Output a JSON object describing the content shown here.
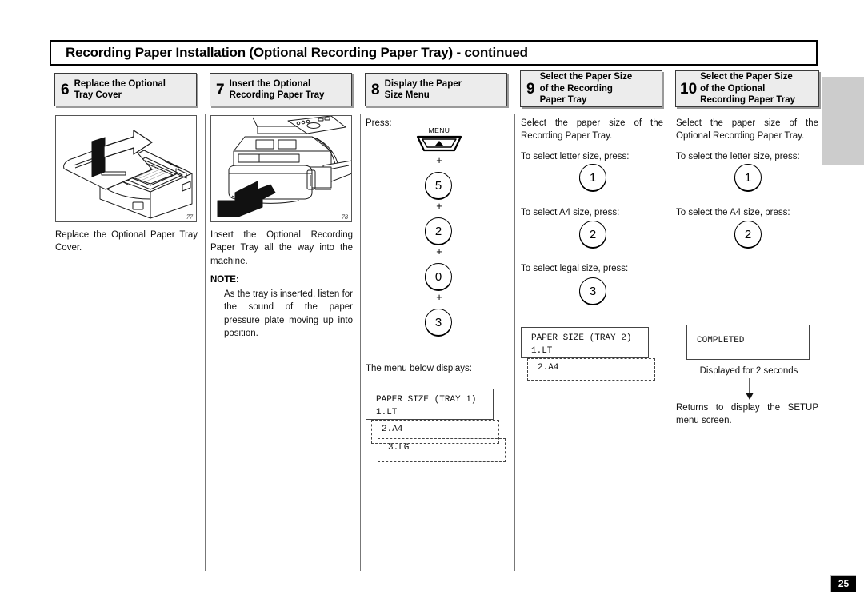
{
  "page": {
    "title": "Recording Paper Installation (Optional Recording Paper Tray) - continued",
    "page_number": "25",
    "colors": {
      "step_header_bg": "#ececec",
      "step_header_border": "#3a3a3a",
      "thumb_tab": "#cccccc",
      "divider": "#777777",
      "page_number_bg": "#000000",
      "page_number_text": "#ffffff"
    }
  },
  "steps": [
    {
      "number": "6",
      "label": "Replace the Optional\nTray Cover",
      "figure_number": "77",
      "figure_alt": "optional-paper-tray-cover-illustration",
      "body": "Replace the Optional Paper Tray Cover."
    },
    {
      "number": "7",
      "label": "Insert the Optional\nRecording Paper Tray",
      "figure_number": "78",
      "figure_alt": "insert-recording-paper-tray-illustration",
      "body": "Insert the Optional Recording Paper Tray all the way into the machine.",
      "note_title": "NOTE:",
      "note_body": "As the tray is inserted, listen for the sound of the paper pressure plate moving up into position."
    },
    {
      "number": "8",
      "label": "Display the Paper\nSize Menu",
      "press_label": "Press:",
      "menu_key_cap": "MENU",
      "menu_key_icon": "up-triangle-icon",
      "keys": [
        "5",
        "2",
        "0",
        "3"
      ],
      "plus_symbol": "+",
      "menu_displays_label": "The menu below displays:",
      "lcd": {
        "line1": "PAPER SIZE (TRAY 1)",
        "line2": "1.LT",
        "ghost1": "2.A4",
        "ghost2": "3.LG"
      }
    },
    {
      "number": "9",
      "label": "Select the Paper Size\nof the Recording\nPaper Tray",
      "body": "Select the paper size of the Recording Paper Tray.",
      "choices": [
        {
          "prompt": "To select letter size, press:",
          "key": "1"
        },
        {
          "prompt": "To select A4 size, press:",
          "key": "2"
        },
        {
          "prompt": "To select legal size, press:",
          "key": "3"
        }
      ],
      "lcd": {
        "line1": "PAPER SIZE (TRAY 2)",
        "line2": "1.LT",
        "ghost1": "2.A4"
      }
    },
    {
      "number": "10",
      "label": "Select the Paper Size\nof the Optional\nRecording Paper Tray",
      "body": "Select the paper size of the Optional Recording Paper Tray.",
      "choices": [
        {
          "prompt": "To select the letter size, press:",
          "key": "1"
        },
        {
          "prompt": "To select the A4 size, press:",
          "key": "2"
        }
      ],
      "lcd": {
        "line1": "COMPLETED"
      },
      "caption": "Displayed for 2 seconds",
      "arrow_icon": "down-arrow-icon",
      "footer": "Returns to display the SETUP menu screen."
    }
  ]
}
